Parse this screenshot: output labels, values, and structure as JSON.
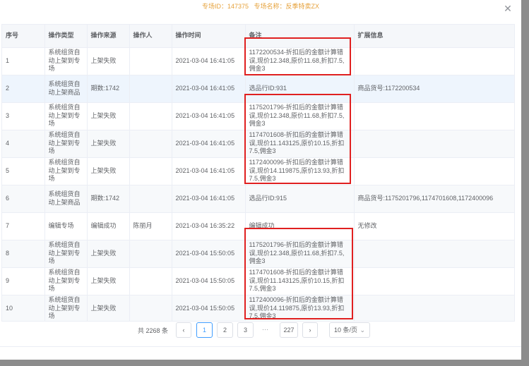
{
  "header": {
    "topic_id_label": "专场ID：147375",
    "topic_name_label": "专场名称：反季特卖ZX"
  },
  "columns": [
    "序号",
    "操作类型",
    "操作来源",
    "操作人",
    "操作时间",
    "备注",
    "扩展信息"
  ],
  "rows": [
    {
      "no": "1",
      "type": "系统组货自动上架到专场",
      "source": "上架失败",
      "operator": "",
      "time": "2021-03-04 16:41:05",
      "remark": "1172200534-折扣后的金额计算错误,现价12.348,原价11.68,折扣7.5,佣金3",
      "ext": ""
    },
    {
      "no": "2",
      "type": "系统组货自动上架商品",
      "source": "期数:1742",
      "operator": "",
      "time": "2021-03-04 16:41:05",
      "remark": "选品行ID:931",
      "ext": "商品货号:1172200534"
    },
    {
      "no": "3",
      "type": "系统组货自动上架到专场",
      "source": "上架失败",
      "operator": "",
      "time": "2021-03-04 16:41:05",
      "remark": "1175201796-折扣后的金额计算错误,现价12.348,原价11.68,折扣7.5,佣金3",
      "ext": ""
    },
    {
      "no": "4",
      "type": "系统组货自动上架到专场",
      "source": "上架失败",
      "operator": "",
      "time": "2021-03-04 16:41:05",
      "remark": "1174701608-折扣后的金额计算错误,现价11.143125,原价10.15,折扣7.5,佣金3",
      "ext": ""
    },
    {
      "no": "5",
      "type": "系统组货自动上架到专场",
      "source": "上架失败",
      "operator": "",
      "time": "2021-03-04 16:41:05",
      "remark": "1172400096-折扣后的金额计算错误,现价14.119875,原价13.93,折扣7.5,佣金3",
      "ext": ""
    },
    {
      "no": "6",
      "type": "系统组货自动上架商品",
      "source": "期数:1742",
      "operator": "",
      "time": "2021-03-04 16:41:05",
      "remark": "选品行ID:915",
      "ext": "商品货号:1175201796,1174701608,1172400096"
    },
    {
      "no": "7",
      "type": "编辑专场",
      "source": "编辑成功",
      "operator": "陈丽月",
      "time": "2021-03-04 16:35:22",
      "remark": "编辑成功",
      "ext": "无修改"
    },
    {
      "no": "8",
      "type": "系统组货自动上架到专场",
      "source": "上架失败",
      "operator": "",
      "time": "2021-03-04 15:50:05",
      "remark": "1175201796-折扣后的金额计算错误,现价12.348,原价11.68,折扣7.5,佣金3",
      "ext": ""
    },
    {
      "no": "9",
      "type": "系统组货自动上架到专场",
      "source": "上架失败",
      "operator": "",
      "time": "2021-03-04 15:50:05",
      "remark": "1174701608-折扣后的金额计算错误,现价11.143125,原价10.15,折扣7.5,佣金3",
      "ext": ""
    },
    {
      "no": "10",
      "type": "系统组货自动上架到专场",
      "source": "上架失败",
      "operator": "",
      "time": "2021-03-04 15:50:05",
      "remark": "1172400096-折扣后的金额计算错误,现价14.119875,原价13.93,折扣7.5,佣金3",
      "ext": ""
    }
  ],
  "pagination": {
    "total": "共 2268 条",
    "prev_icon": "chevron-left-icon",
    "pages": [
      "1",
      "2",
      "3"
    ],
    "ellipsis": "···",
    "last_page": "227",
    "next_icon": "chevron-right-icon",
    "page_size": "10 条/页"
  },
  "colors": {
    "accent": "#409eff",
    "warning": "#e6a23c",
    "highlight_box": "#e02020"
  }
}
